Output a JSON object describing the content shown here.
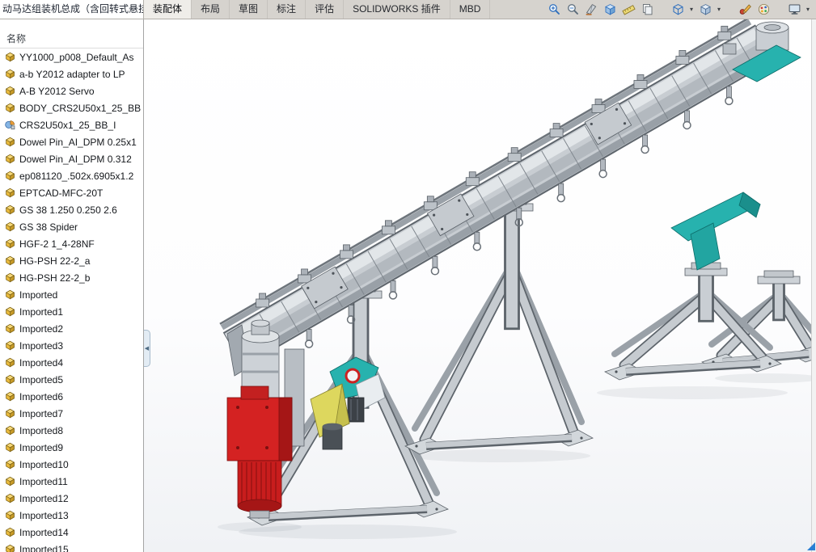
{
  "app": {
    "assembly_title": "动马达组装机总成（含回转式悬挂",
    "tree_header": "名称"
  },
  "ribbon": {
    "tabs": [
      {
        "key": "assembly",
        "label": "装配体",
        "active": true
      },
      {
        "key": "layout",
        "label": "布局",
        "active": false
      },
      {
        "key": "sketch",
        "label": "草图",
        "active": false
      },
      {
        "key": "markup",
        "label": "标注",
        "active": false
      },
      {
        "key": "evaluate",
        "label": "评估",
        "active": false
      },
      {
        "key": "addins",
        "label": "SOLIDWORKS 插件",
        "active": false
      },
      {
        "key": "mbd",
        "label": "MBD",
        "active": false
      }
    ]
  },
  "toolbar": {
    "icons": [
      {
        "name": "zoom-in-icon",
        "glyph": "magnifier-plus"
      },
      {
        "name": "zoom-area-icon",
        "glyph": "magnifier"
      },
      {
        "name": "section-view-icon",
        "glyph": "blade"
      },
      {
        "name": "assembly-visualization-icon",
        "glyph": "cube-blue"
      },
      {
        "name": "measure-icon",
        "glyph": "ruler"
      },
      {
        "name": "mass-properties-icon",
        "glyph": "pages"
      },
      {
        "gap": true
      },
      {
        "name": "view-orientation-icon",
        "glyph": "cube-outline",
        "dropdown": true
      },
      {
        "name": "display-style-icon",
        "glyph": "cube-shaded",
        "dropdown": true
      },
      {
        "gap": true
      },
      {
        "name": "edit-appearance-icon",
        "glyph": "pencil"
      },
      {
        "name": "apply-scene-icon",
        "glyph": "palette"
      },
      {
        "gap": true
      },
      {
        "name": "view-settings-icon",
        "glyph": "monitor",
        "dropdown": true
      }
    ]
  },
  "tree": {
    "items": [
      {
        "label": "YY1000_p008_Default_As",
        "icon": "part"
      },
      {
        "label": "a-b Y2012 adapter to LP",
        "icon": "part"
      },
      {
        "label": "A-B Y2012 Servo",
        "icon": "part"
      },
      {
        "label": "BODY_CRS2U50x1_25_BB",
        "icon": "part"
      },
      {
        "label": "CRS2U50x1_25_BB_I",
        "icon": "profile"
      },
      {
        "label": "Dowel Pin_AI_DPM 0.25x1",
        "icon": "part"
      },
      {
        "label": "Dowel Pin_AI_DPM 0.312",
        "icon": "part"
      },
      {
        "label": "ep081120_.502x.6905x1.2",
        "icon": "part"
      },
      {
        "label": "EPTCAD-MFC-20T",
        "icon": "part"
      },
      {
        "label": "GS 38  1.250 0.250 2.6",
        "icon": "part"
      },
      {
        "label": "GS 38 Spider",
        "icon": "part"
      },
      {
        "label": "HGF-2 1_4-28NF",
        "icon": "part"
      },
      {
        "label": "HG-PSH 22-2_a",
        "icon": "part"
      },
      {
        "label": "HG-PSH 22-2_b",
        "icon": "part"
      },
      {
        "label": "Imported",
        "icon": "part"
      },
      {
        "label": "Imported1",
        "icon": "part"
      },
      {
        "label": "Imported2",
        "icon": "part"
      },
      {
        "label": "Imported3",
        "icon": "part"
      },
      {
        "label": "Imported4",
        "icon": "part"
      },
      {
        "label": "Imported5",
        "icon": "part"
      },
      {
        "label": "Imported6",
        "icon": "part"
      },
      {
        "label": "Imported7",
        "icon": "part"
      },
      {
        "label": "Imported8",
        "icon": "part"
      },
      {
        "label": "Imported9",
        "icon": "part"
      },
      {
        "label": "Imported10",
        "icon": "part"
      },
      {
        "label": "Imported11",
        "icon": "part"
      },
      {
        "label": "Imported12",
        "icon": "part"
      },
      {
        "label": "Imported13",
        "icon": "part"
      },
      {
        "label": "Imported14",
        "icon": "part"
      },
      {
        "label": "Imported15",
        "icon": "part"
      }
    ]
  },
  "viewport": {
    "model": "overhead-conveyor-motor-assembly",
    "colors": {
      "frame_gray": "#c8cdd2",
      "motor_red": "#d42222",
      "accent_teal": "#27b2ae",
      "accent_yellow": "#ddd75e"
    }
  }
}
